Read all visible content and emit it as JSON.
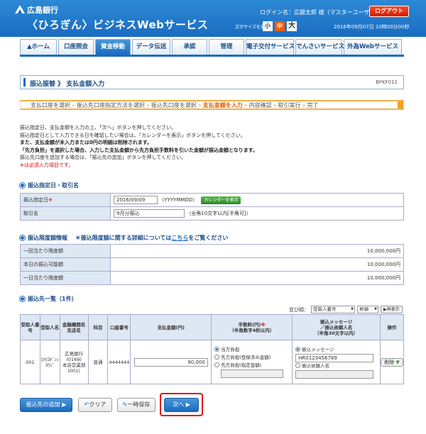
{
  "header": {
    "bank_name": "広島銀行",
    "service_name": "〈ひろぎん〉ビジネスWebサービス",
    "login_name": "ログイン名：広銀太郎 様（マスターユーザ）",
    "logout": "ログアウト",
    "font_size_label": "文字サイズを変更",
    "font_sizes": [
      "小",
      "中",
      "大"
    ],
    "datetime": "2016年09月07日 10時00分00秒"
  },
  "nav": {
    "items": [
      "ホーム",
      "口座照会",
      "資金移動",
      "データ伝送",
      "承認",
      "管理",
      "電子交付サービス",
      "でんさいサービス",
      "外為Webサービス"
    ],
    "active_index": 2
  },
  "page": {
    "title": "振込振替 》 支払金額入力",
    "id": "BFKF011"
  },
  "steps": {
    "items": [
      "支払口座を選択",
      "振込先口座指定方法を選択",
      "振込先口座を選択",
      "支払金額を入力",
      "内容確認",
      "取引実行",
      "完了"
    ],
    "current_index": 3,
    "separator": "»"
  },
  "instructions": {
    "lines": [
      "振込指定日、支払金額を入力の上、「次へ」ボタンを押してください。",
      "振込指定日として入力できる日を確認したい場合は、「カレンダーを表示」ボタンを押してください。",
      "また、支払金額が未入力または0円の明細は削除されます。",
      "「先方負担」を選択した場合、入力した支払金額から先方負担手数料を引いた金額が振込金額となります。",
      "振込先口座を追加する場合は、「振込先の追加」ボタンを押してください。",
      "※は必須入力項目です。"
    ]
  },
  "section_date": {
    "heading": "振込指定日・取引名",
    "date_label": "振込指定日",
    "required_mark": "※",
    "date_value": "2016/09/09",
    "date_hint": "（YYYYMMDD）",
    "calendar_button": "カレンダーを表示",
    "name_label": "取引名",
    "name_value": "9月分振込",
    "name_hint": "（全角10文字以内[半角可]）"
  },
  "section_limit": {
    "heading": "振込限度額情報",
    "note_prefix": "＊振込限度額に関する詳細については",
    "note_link": "こちら",
    "note_suffix": "をご覧ください",
    "rows": [
      {
        "label": "一回当たり限度額",
        "value": "10,000,000円"
      },
      {
        "label": "本日の振込可能額",
        "value": "10,000,000円"
      },
      {
        "label": "一日当たり限度額",
        "value": "10,000,000円"
      }
    ]
  },
  "section_list": {
    "heading": "振込先一覧（1件）",
    "sort_label": "並び順：",
    "sort_value": "受取人番号",
    "order_value": "昇順",
    "redisplay": "再表示",
    "columns": {
      "recipient_no": "受取人番号",
      "recipient_name": "受取人名",
      "bank_branch": "金融機関名\n支店名",
      "subject": "科目",
      "account_no": "口座番号",
      "amount": "支払金額(円)",
      "fee": "手数料(円)",
      "fee_required": "※",
      "fee_sub": "（半角数字4桁以内）",
      "message": "振込メッセージ\n／振込依頼人名",
      "message_sub": "（半角30文字以内）",
      "operation": "操作"
    },
    "row": {
      "recipient_no": "001",
      "recipient_name": "ｶ)ﾋﾛｷﾞﾝｼﾖｳｼﾞ",
      "bank": "広島銀行(0169)",
      "branch": "本店営業部(001)",
      "subject": "普通",
      "account_no": "4444444",
      "amount": "90,000",
      "fee_options": [
        "当方負担",
        "先方負担(登録済み金額)",
        "先方負担(指定金額)"
      ],
      "fee_selected": 0,
      "message_options": [
        "振込メッセージ",
        "振込依頼人名"
      ],
      "message_selected": 0,
      "message_value": "HR0123456789",
      "delete": "削除"
    }
  },
  "buttons": {
    "add_recipient": "振込先の追加",
    "clear": "クリア",
    "temp_save": "一時保存",
    "next": "次へ"
  }
}
